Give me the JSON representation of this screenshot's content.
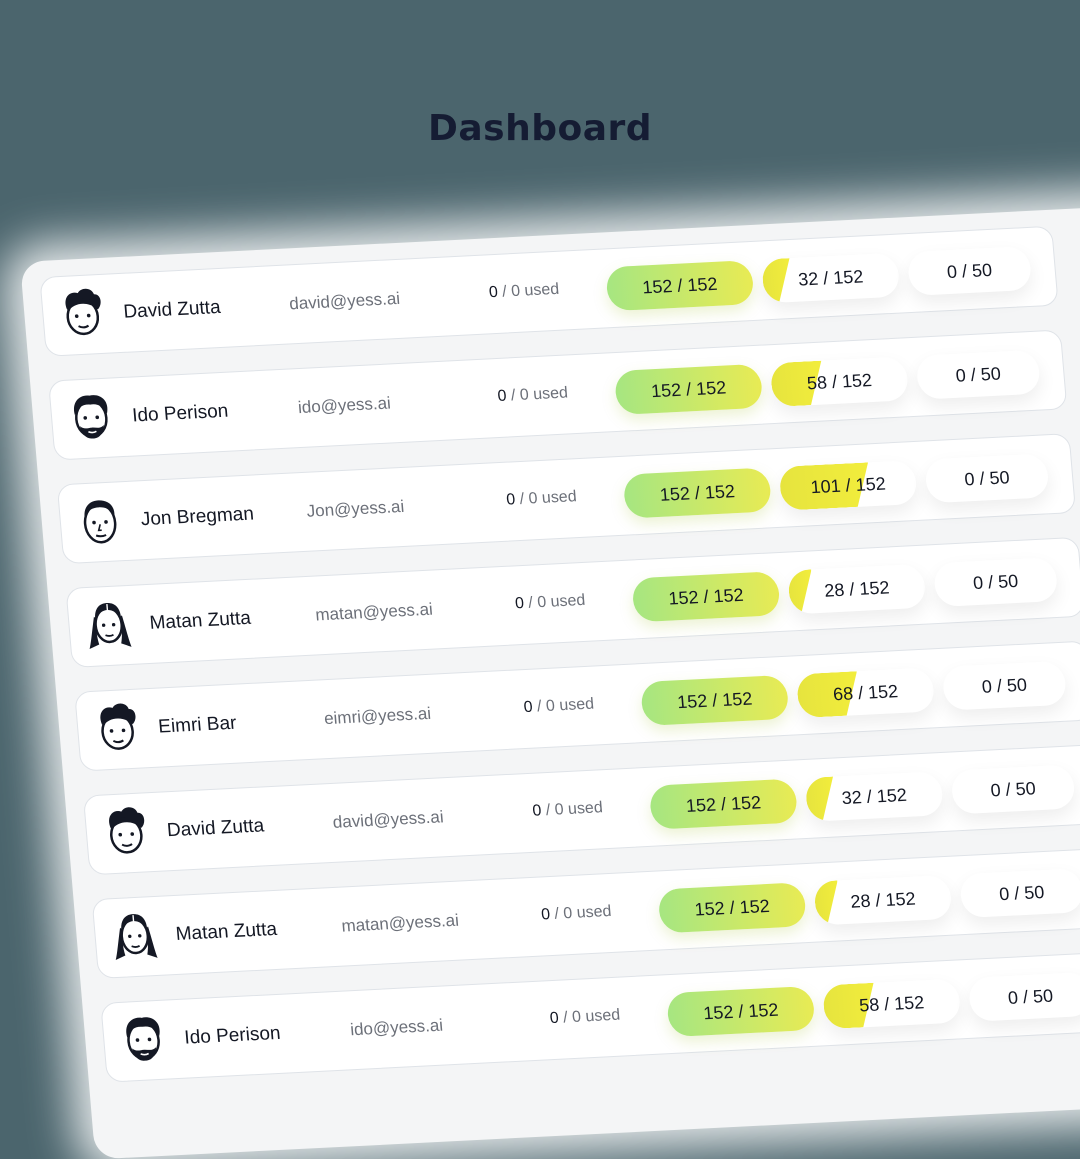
{
  "page": {
    "title": "Dashboard"
  },
  "users": [
    {
      "name": "David Zutta",
      "email": "david@yess.ai",
      "used_count": "0",
      "used_text": "/ 0 used",
      "credits": "152 / 152",
      "usage": "32 / 152",
      "usage_fraction": 0.21,
      "quota": "0 / 50",
      "avatar_icon": "messy-hair-man-avatar-icon"
    },
    {
      "name": "Ido Perison",
      "email": "ido@yess.ai",
      "used_count": "0",
      "used_text": "/ 0 used",
      "credits": "152 / 152",
      "usage": "58 / 152",
      "usage_fraction": 0.38,
      "quota": "0 / 50",
      "avatar_icon": "bearded-man-avatar-icon"
    },
    {
      "name": "Jon Bregman",
      "email": "Jon@yess.ai",
      "used_count": "0",
      "used_text": "/ 0 used",
      "credits": "152 / 152",
      "usage": "101 / 152",
      "usage_fraction": 0.66,
      "quota": "0 / 50",
      "avatar_icon": "short-hair-man-avatar-icon"
    },
    {
      "name": "Matan Zutta",
      "email": "matan@yess.ai",
      "used_count": "0",
      "used_text": "/ 0 used",
      "credits": "152 / 152",
      "usage": "28 / 152",
      "usage_fraction": 0.18,
      "quota": "0 / 50",
      "avatar_icon": "long-hair-avatar-icon"
    },
    {
      "name": "Eimri Bar",
      "email": "eimri@yess.ai",
      "used_count": "0",
      "used_text": "/ 0 used",
      "credits": "152 / 152",
      "usage": "68 / 152",
      "usage_fraction": 0.45,
      "quota": "0 / 50",
      "avatar_icon": "messy-hair-man-avatar-icon"
    },
    {
      "name": "David Zutta",
      "email": "david@yess.ai",
      "used_count": "0",
      "used_text": "/ 0 used",
      "credits": "152 / 152",
      "usage": "32 / 152",
      "usage_fraction": 0.21,
      "quota": "0 / 50",
      "avatar_icon": "messy-hair-man-avatar-icon"
    },
    {
      "name": "Matan Zutta",
      "email": "matan@yess.ai",
      "used_count": "0",
      "used_text": "/ 0 used",
      "credits": "152 / 152",
      "usage": "28 / 152",
      "usage_fraction": 0.18,
      "quota": "0 / 50",
      "avatar_icon": "long-hair-avatar-icon"
    },
    {
      "name": "Ido Perison",
      "email": "ido@yess.ai",
      "used_count": "0",
      "used_text": "/ 0 used",
      "credits": "152 / 152",
      "usage": "58 / 152",
      "usage_fraction": 0.38,
      "quota": "0 / 50",
      "avatar_icon": "bearded-man-avatar-icon"
    }
  ],
  "colors": {
    "background": "#4b656d",
    "title": "#151c33",
    "credits_gradient_start": "#a6e681",
    "credits_gradient_end": "#e8eb54",
    "usage_fill": "#e6e43e"
  }
}
